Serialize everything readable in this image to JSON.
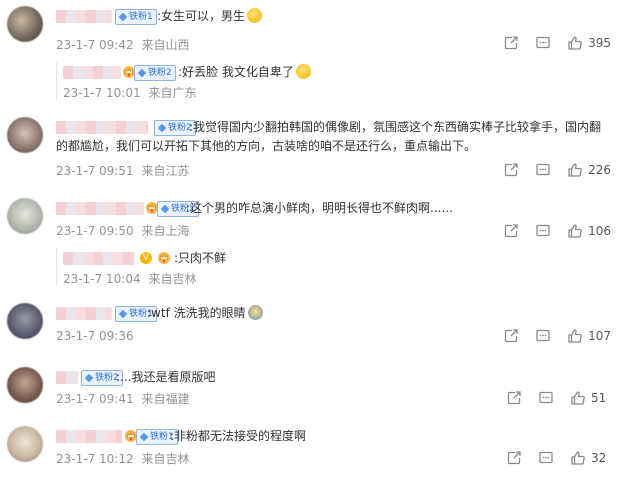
{
  "comments": [
    {
      "badge": "铁粉1",
      "text": ":女生可以，男生",
      "time": "23-1-7 09:42",
      "location": "来自山西",
      "likes": "395"
    },
    {
      "badge": "铁粉2",
      "text": ":好丢脸 我文化自卑了",
      "time": "23-1-7 10:01",
      "location": "来自广东",
      "is_reply": true
    },
    {
      "badge": "铁粉2",
      "text_line1": ":我觉得国内少翻拍韩国的偶像剧，氛围感这个东西确实棒子比较拿手，国内翻",
      "text_line2": "的都尴尬，我们可以开拓下其他的方向，古装啥的咱不是还行么，重点输出下。",
      "time": "23-1-7 09:51",
      "location": "来自江苏",
      "likes": "226"
    },
    {
      "badge": "铁粉2",
      "text": ":这个男的咋总演小鲜肉，明明长得也不鲜肉啊......",
      "time": "23-1-7 09:50",
      "location": "来自上海",
      "likes": "106"
    },
    {
      "text": ":只肉不鲜",
      "time": "23-1-7 10:04",
      "location": "来自吉林",
      "is_reply": true
    },
    {
      "badge": "铁粉1",
      "text": ":wtf 洗洗我的眼睛",
      "time": "23-1-7 09:36",
      "location": "",
      "likes": "107"
    },
    {
      "badge": "铁粉2",
      "text": ":...我还是看原版吧",
      "time": "23-1-7 09:41",
      "location": "来自福建",
      "likes": "51"
    },
    {
      "badge": "铁粉1",
      "text": ":非粉都无法接受的程度啊",
      "time": "23-1-7 10:12",
      "location": "来自吉林",
      "likes": "32"
    }
  ],
  "icons": {
    "share": "share-icon",
    "comment": "comment-icon",
    "like": "like-icon"
  },
  "colors": {
    "badge_blue": "#2d6fd4",
    "meta_gray": "#939393"
  }
}
